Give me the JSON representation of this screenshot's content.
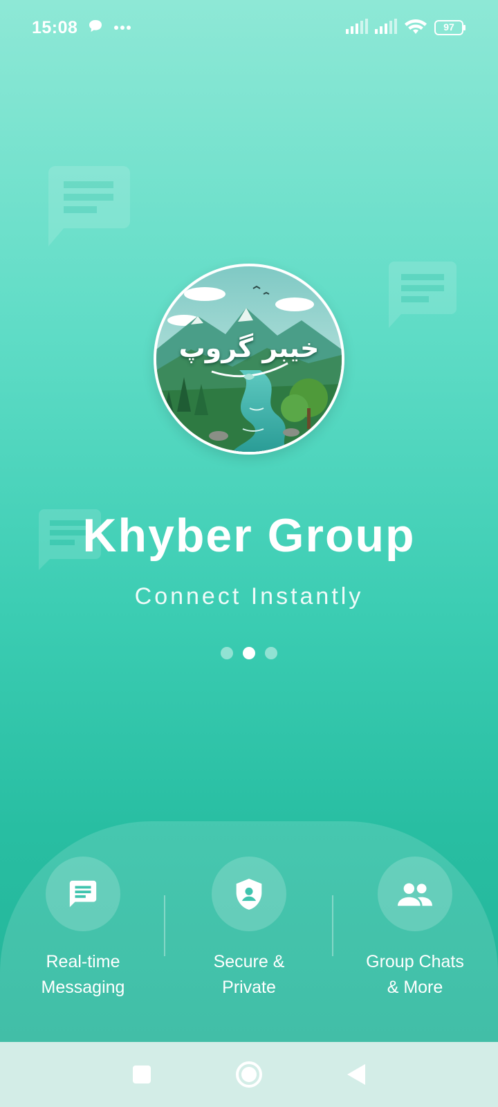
{
  "status_bar": {
    "time": "15:08",
    "battery": "97",
    "icons": [
      "chat-notification-icon",
      "more-dots-icon",
      "signal-icon",
      "signal-icon",
      "wifi-icon",
      "battery-icon"
    ]
  },
  "logo": {
    "urdu_text": "خیبر گروپ"
  },
  "app": {
    "title": "Khyber Group",
    "subtitle": "Connect Instantly"
  },
  "pager": {
    "count": 3,
    "active_index": 1
  },
  "features": [
    {
      "icon": "message-icon",
      "label": "Real-time\nMessaging"
    },
    {
      "icon": "shield-icon",
      "label": "Secure &\nPrivate"
    },
    {
      "icon": "group-icon",
      "label": "Group Chats\n& More"
    }
  ],
  "nav_bar": {
    "buttons": [
      "recent-apps-button",
      "home-button",
      "back-button"
    ]
  },
  "colors": {
    "gradient_top": "#8ee8d6",
    "gradient_bottom": "#22b196",
    "nav_bar": "#d3ede7",
    "icon_teal": "#3fc4ae"
  }
}
